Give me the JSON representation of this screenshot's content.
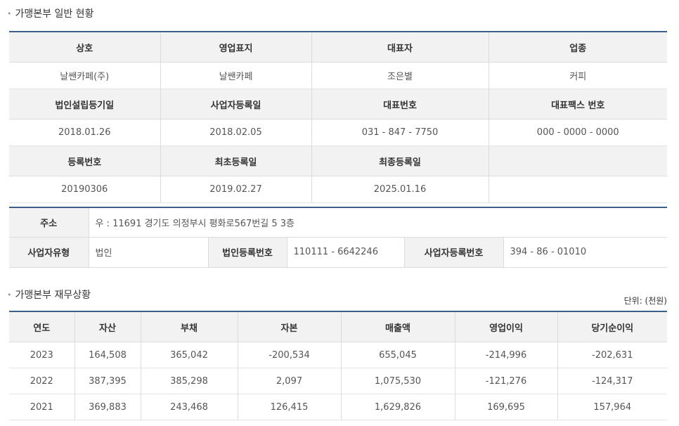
{
  "section1": {
    "title": "가맹본부 일반 현황"
  },
  "general": {
    "h1": [
      "상호",
      "영업표지",
      "대표자",
      "업종"
    ],
    "v1": [
      "날쌘카페(주)",
      "날쌘카페",
      "조은별",
      "커피"
    ],
    "h2": [
      "법인설립등기일",
      "사업자등록일",
      "대표번호",
      "대표팩스 번호"
    ],
    "v2": [
      "2018.01.26",
      "2018.02.05",
      "031 - 847 - 7750",
      "000 - 0000 - 0000"
    ],
    "h3": [
      "등록번호",
      "최초등록일",
      "최종등록일",
      ""
    ],
    "v3": [
      "20190306",
      "2019.02.27",
      "2025.01.16",
      ""
    ]
  },
  "address": {
    "label": "주소",
    "value": "우 : 11691 경기도 의정부시 평화로567번길 5 3층",
    "biz_type_label": "사업자유형",
    "biz_type": "법인",
    "corp_no_label": "법인등록번호",
    "corp_no": "110111 - 6642246",
    "biz_no_label": "사업자등록번호",
    "biz_no": "394 - 86 - 01010"
  },
  "section2": {
    "title": "가맹본부 재무상황",
    "unit": "단위: (천원)"
  },
  "finance": {
    "headers": [
      "연도",
      "자산",
      "부채",
      "자본",
      "매출액",
      "영업이익",
      "당기순이익"
    ],
    "rows": [
      [
        "2023",
        "164,508",
        "365,042",
        "-200,534",
        "655,045",
        "-214,996",
        "-202,631"
      ],
      [
        "2022",
        "387,395",
        "385,298",
        "2,097",
        "1,075,530",
        "-121,276",
        "-124,317"
      ],
      [
        "2021",
        "369,883",
        "243,468",
        "126,415",
        "1,629,826",
        "169,695",
        "157,964"
      ]
    ]
  }
}
